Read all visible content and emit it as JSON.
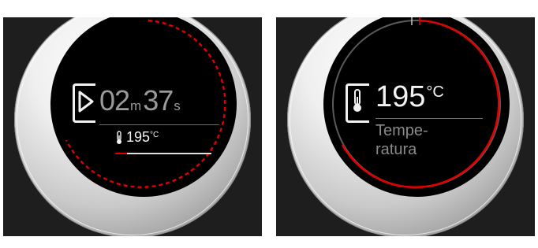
{
  "left_display": {
    "timer": {
      "minutes": "02",
      "minutes_unit": "m",
      "seconds": "37",
      "seconds_unit": "s"
    },
    "temperature": {
      "value": "195",
      "unit": "°C"
    },
    "progress": 0.12,
    "accent_color": "#e10000",
    "icons": [
      "play-icon",
      "thermometer-icon"
    ]
  },
  "right_display": {
    "temperature": {
      "value": "195",
      "unit": "°C"
    },
    "label_line1": "Tempe-",
    "label_line2": "ratura",
    "accent_color": "#e10000",
    "icons": [
      "thermometer-icon"
    ]
  }
}
